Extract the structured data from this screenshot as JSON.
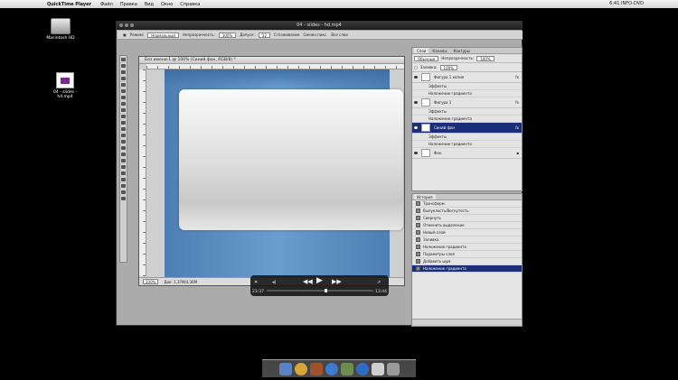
{
  "menubar": {
    "app": "QuickTime Player",
    "items": [
      "Файл",
      "Правка",
      "Вид",
      "Окно",
      "Справка"
    ],
    "status": "6:41  INFO-DVD"
  },
  "desktop": {
    "hd_label": "Macintosh HD",
    "file_label": "04 - slides - hd.mp4"
  },
  "window": {
    "title": "04 - slides - hd.mp4"
  },
  "options_bar": {
    "mode_label": "Режим:",
    "mode_value": "Нормальный",
    "opacity_label": "Непрозрачность:",
    "opacity_value": "100%",
    "tolerance_label": "Допуск:",
    "tolerance_value": "32",
    "antialias": "Сглаживание",
    "contiguous": "Смежн.пикс.",
    "all_layers": "Все слои"
  },
  "document": {
    "title": "Без имени-1 @ 100% (Синий фон, RGB/8) *",
    "zoom": "100%",
    "doc_size": "Док: 1,37M/4,36M"
  },
  "layers_panel": {
    "tabs": [
      "Слои",
      "Каналы",
      "Контуры"
    ],
    "blend": "Обычные",
    "opacity_label": "Непрозрачность:",
    "opacity_value": "100%",
    "fill_label": "Заливка:",
    "fill_value": "100%",
    "rows": [
      {
        "name": "Фигура 1 копия",
        "fx": "fx",
        "effects": "Эффекты",
        "sub": "Наложение градиента"
      },
      {
        "name": "Фигура 1",
        "fx": "fx",
        "effects": "Эффекты",
        "sub": "Наложение градиента"
      },
      {
        "name": "Синий фон",
        "fx": "fx",
        "effects": "Эффекты",
        "sub": "Наложение градиента"
      },
      {
        "name": "Фон",
        "fx": "",
        "effects": "",
        "sub": ""
      }
    ]
  },
  "history_panel": {
    "title": "История",
    "rows": [
      "Трансформ.",
      "Выпуклость/Вогнутость",
      "Свернуть",
      "Отменить выделение",
      "Новый слой",
      "Заливка",
      "Наложение градиента",
      "Параметры слоя",
      "Добавить шум",
      "Наложение градиента"
    ]
  },
  "player": {
    "elapsed": "23:37",
    "remaining": "- 13:44"
  }
}
